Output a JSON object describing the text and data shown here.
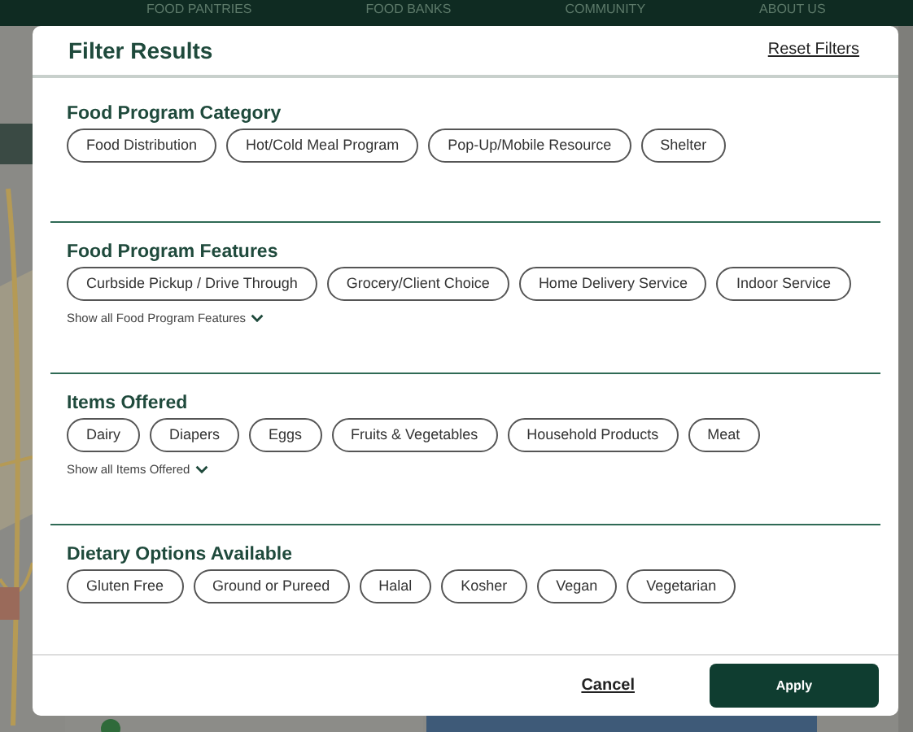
{
  "nav": [
    "FOOD PANTRIES",
    "FOOD BANKS",
    "COMMUNITY",
    "ABOUT US"
  ],
  "modal": {
    "title": "Filter Results",
    "reset": "Reset Filters",
    "sections": [
      {
        "title": "Food Program Category",
        "options": [
          {
            "label": "Food Distribution",
            "selected": false
          },
          {
            "label": "Hot/Cold Meal Program",
            "selected": false
          },
          {
            "label": "Pop-Up/Mobile Resource",
            "selected": false
          },
          {
            "label": "Shelter",
            "selected": false
          }
        ]
      },
      {
        "title": "Food Program Features",
        "options": [
          {
            "label": "Curbside Pickup / Drive Through",
            "selected": false
          },
          {
            "label": "Grocery/Client Choice",
            "selected": false
          },
          {
            "label": "Home Delivery Service",
            "selected": false
          },
          {
            "label": "Indoor Service",
            "selected": false
          }
        ],
        "show_all": "Show all Food Program Features"
      },
      {
        "title": "Items Offered",
        "options": [
          {
            "label": "Dairy",
            "selected": false
          },
          {
            "label": "Diapers",
            "selected": false
          },
          {
            "label": "Eggs",
            "selected": false
          },
          {
            "label": "Fruits & Vegetables",
            "selected": false
          },
          {
            "label": "Household Products",
            "selected": false
          },
          {
            "label": "Meat",
            "selected": false
          }
        ],
        "show_all": "Show all Items Offered"
      },
      {
        "title": "Dietary Options Available",
        "options": [
          {
            "label": "Gluten Free",
            "selected": false
          },
          {
            "label": "Ground or Pureed",
            "selected": false
          },
          {
            "label": "Halal",
            "selected": false
          },
          {
            "label": "Kosher",
            "selected": false
          },
          {
            "label": "Vegan",
            "selected": false
          },
          {
            "label": "Vegetarian",
            "selected": false
          }
        ]
      }
    ],
    "cancel": "Cancel",
    "apply": "Apply"
  }
}
